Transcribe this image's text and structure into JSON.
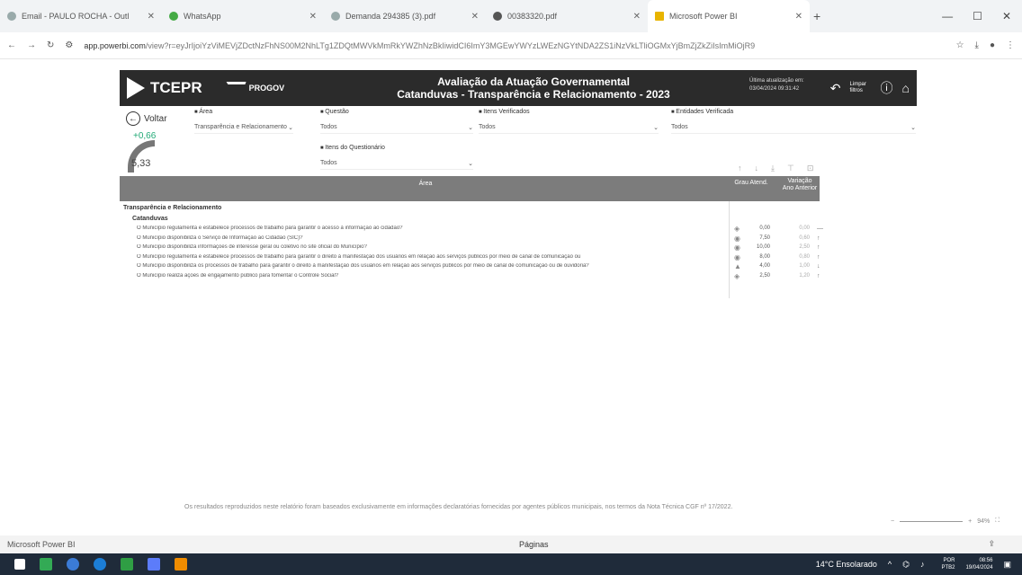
{
  "browser": {
    "tabs": [
      {
        "title": "Email - PAULO ROCHA - Outl",
        "active": false
      },
      {
        "title": "WhatsApp",
        "active": false
      },
      {
        "title": "Demanda 294385 (3).pdf",
        "active": false
      },
      {
        "title": "00383320.pdf",
        "active": false
      },
      {
        "title": "Microsoft Power BI",
        "active": true
      }
    ],
    "url_domain": "app.powerbi.com",
    "url_rest": "/view?r=eyJrIjoiYzViMEVjZDctNzFhNS00M2NhLTg1ZDQtMWVkMmRkYWZhNzBkIiwidCI6ImY3MGEwYWYzLWEzNGYtNDA2ZS1iNzVkLTliOGMxYjBmZjZkZiIsImMiOjR9"
  },
  "report": {
    "logo": "TCEPR",
    "progov": "PROGOV",
    "title_line1": "Avaliação da Atuação Governamental",
    "title_line2": "Catanduvas - Transparência e Relacionamento - 2023",
    "update_label": "Última atualização em:",
    "update_value": "03/04/2024 09:31:42",
    "clear_filters": "Limpar filtros"
  },
  "back_label": "Voltar",
  "gauge": {
    "delta": "+0,66",
    "value": "5,33"
  },
  "filters": {
    "area": {
      "label": "Área",
      "value": "Transparência e Relacionamento"
    },
    "questao": {
      "label": "Questão",
      "value": "Todos"
    },
    "itens_verificados": {
      "label": "Itens Verificados",
      "value": "Todos"
    },
    "entidades": {
      "label": "Entidades Verificada",
      "value": "Todos"
    },
    "itens_questionario": {
      "label": "Itens do Questionário",
      "value": "Todos"
    }
  },
  "table": {
    "headers": {
      "area": "Área",
      "nota": "Grau Atend.",
      "variacao": "Variação Ano Anterior"
    },
    "group": "Transparência e Relacionamento",
    "subgroup": "Catanduvas",
    "rows": [
      {
        "text": "O Município regulamenta e estabelece processos de trabalho para garantir o acesso à informação ao cidadão?",
        "nota": "0,00",
        "var": "0,00",
        "arrow": "—"
      },
      {
        "text": "O Município disponibiliza o Serviço de Informação ao Cidadão (SIC)?",
        "nota": "7,50",
        "var": "0,60",
        "arrow": "↑"
      },
      {
        "text": "O Município disponibiliza informações de interesse geral ou coletivo no site oficial do Município?",
        "nota": "10,00",
        "var": "2,50",
        "arrow": "↑"
      },
      {
        "text": "O Município regulamenta e estabelece processos de trabalho para garantir o direito à manifestação dos usuários em relação aos serviços públicos por meio de canal de comunicação ou",
        "nota": "8,00",
        "var": "0,80",
        "arrow": "↑"
      },
      {
        "text": "O Município disponibiliza os processos de trabalho para garantir o direito à manifestação dos usuários em relação aos serviços públicos por meio de canal de comunicação ou de ouvidoria?",
        "nota": "4,00",
        "var": "1,00",
        "arrow": "↓"
      },
      {
        "text": "O Município realiza ações de engajamento público para fomentar o Controle Social?",
        "nota": "2,50",
        "var": "1,20",
        "arrow": "↑"
      }
    ]
  },
  "footnote": "Os resultados reproduzidos neste relatório foram baseados exclusivamente em informações declaratórias fornecidas por agentes públicos municipais, nos termos da Nota Técnica CGF nº 17/2022.",
  "zoom": "94%",
  "status": {
    "left": "Microsoft Power BI",
    "center": "Páginas"
  },
  "taskbar": {
    "weather": "14°C Ensolarado",
    "lang": "POR PTB2",
    "time": "08:56",
    "date": "19/04/2024"
  }
}
